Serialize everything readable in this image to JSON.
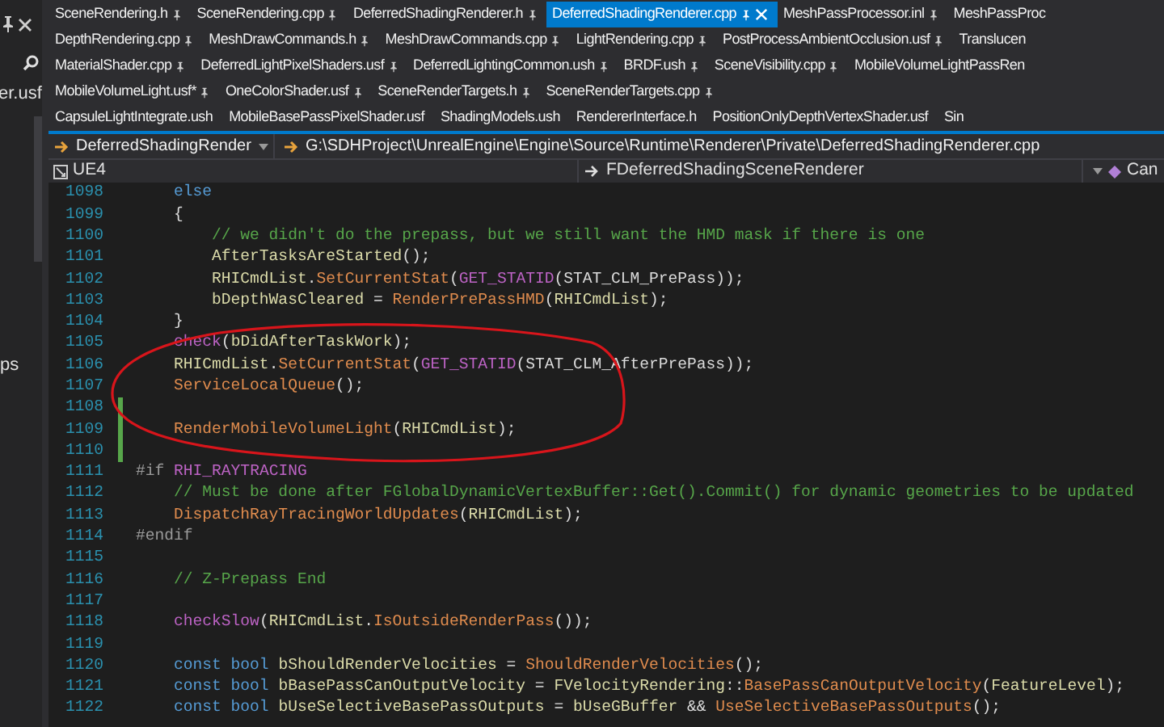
{
  "left_panel": {
    "items": [
      "er.usf",
      "ps"
    ]
  },
  "tab_rows": [
    [
      {
        "label": "SceneRendering.h",
        "selected": false,
        "pinned": true
      },
      {
        "label": "SceneRendering.cpp",
        "selected": false,
        "pinned": true
      },
      {
        "label": "DeferredShadingRenderer.h",
        "selected": false,
        "pinned": true
      },
      {
        "label": "DeferredShadingRenderer.cpp",
        "selected": true,
        "pinned": true
      },
      {
        "label": "MeshPassProcessor.inl",
        "selected": false,
        "pinned": true
      },
      {
        "label": "MeshPassProc",
        "selected": false,
        "pinned": false
      }
    ],
    [
      {
        "label": "DepthRendering.cpp",
        "selected": false,
        "pinned": true
      },
      {
        "label": "MeshDrawCommands.h",
        "selected": false,
        "pinned": true
      },
      {
        "label": "MeshDrawCommands.cpp",
        "selected": false,
        "pinned": true
      },
      {
        "label": "LightRendering.cpp",
        "selected": false,
        "pinned": true
      },
      {
        "label": "PostProcessAmbientOcclusion.usf",
        "selected": false,
        "pinned": true
      },
      {
        "label": "Translucen",
        "selected": false,
        "pinned": false
      }
    ],
    [
      {
        "label": "MaterialShader.cpp",
        "selected": false,
        "pinned": true
      },
      {
        "label": "DeferredLightPixelShaders.usf",
        "selected": false,
        "pinned": true
      },
      {
        "label": "DeferredLightingCommon.ush",
        "selected": false,
        "pinned": true
      },
      {
        "label": "BRDF.ush",
        "selected": false,
        "pinned": true
      },
      {
        "label": "SceneVisibility.cpp",
        "selected": false,
        "pinned": true
      },
      {
        "label": "MobileVolumeLightPassRen",
        "selected": false,
        "pinned": false
      }
    ],
    [
      {
        "label": "MobileVolumeLight.usf*",
        "selected": false,
        "pinned": true
      },
      {
        "label": "OneColorShader.usf",
        "selected": false,
        "pinned": true
      },
      {
        "label": "SceneRenderTargets.h",
        "selected": false,
        "pinned": true
      },
      {
        "label": "SceneRenderTargets.cpp",
        "selected": false,
        "pinned": true
      }
    ],
    [
      {
        "label": "CapsuleLightIntegrate.ush",
        "selected": false,
        "pinned": false
      },
      {
        "label": "MobileBasePassPixelShader.usf",
        "selected": false,
        "pinned": false
      },
      {
        "label": "ShadingModels.ush",
        "selected": false,
        "pinned": false
      },
      {
        "label": "RendererInterface.h",
        "selected": false,
        "pinned": false
      },
      {
        "label": "PositionOnlyDepthVertexShader.usf",
        "selected": false,
        "pinned": false
      },
      {
        "label": "Sin",
        "selected": false,
        "pinned": false
      }
    ]
  ],
  "navigation": {
    "project": "DeferredShadingRender",
    "path": "G:\\SDHProject\\UnrealEngine\\Engine\\Source\\Runtime\\Renderer\\Private\\DeferredShadingRenderer.cpp"
  },
  "breadcrumb": {
    "project": "UE4",
    "scope": "FDeferredShadingSceneRenderer",
    "member": "Can"
  },
  "editor": {
    "lines": [
      {
        "number": "1098",
        "modified": false,
        "tokens": [
          {
            "kind": "keyword",
            "text": "    else"
          }
        ]
      },
      {
        "number": "1099",
        "modified": false,
        "tokens": [
          {
            "kind": "plain",
            "text": "    {"
          }
        ]
      },
      {
        "number": "1100",
        "modified": false,
        "tokens": [
          {
            "kind": "comment",
            "text": "        // we didn't do the prepass, but we still want the HMD mask if there is one"
          }
        ]
      },
      {
        "number": "1101",
        "modified": false,
        "tokens": [
          {
            "kind": "variable",
            "text": "        AfterTasksAreStarted"
          },
          {
            "kind": "plain",
            "text": "();"
          }
        ]
      },
      {
        "number": "1102",
        "modified": false,
        "tokens": [
          {
            "kind": "variable",
            "text": "        RHICmdList"
          },
          {
            "kind": "plain",
            "text": "."
          },
          {
            "kind": "function",
            "text": "SetCurrentStat"
          },
          {
            "kind": "plain",
            "text": "("
          },
          {
            "kind": "macro",
            "text": "GET_STATID"
          },
          {
            "kind": "plain",
            "text": "(STAT_CLM_PrePass));"
          }
        ]
      },
      {
        "number": "1103",
        "modified": false,
        "tokens": [
          {
            "kind": "variable",
            "text": "        bDepthWasCleared"
          },
          {
            "kind": "plain",
            "text": " = "
          },
          {
            "kind": "function",
            "text": "RenderPrePassHMD"
          },
          {
            "kind": "plain",
            "text": "("
          },
          {
            "kind": "variable",
            "text": "RHICmdList"
          },
          {
            "kind": "plain",
            "text": ");"
          }
        ]
      },
      {
        "number": "1104",
        "modified": false,
        "tokens": [
          {
            "kind": "plain",
            "text": "    }"
          }
        ]
      },
      {
        "number": "1105",
        "modified": false,
        "tokens": [
          {
            "kind": "macro",
            "text": "    check"
          },
          {
            "kind": "plain",
            "text": "("
          },
          {
            "kind": "variable",
            "text": "bDidAfterTaskWork"
          },
          {
            "kind": "plain",
            "text": ");"
          }
        ]
      },
      {
        "number": "1106",
        "modified": false,
        "tokens": [
          {
            "kind": "variable",
            "text": "    RHICmdList"
          },
          {
            "kind": "plain",
            "text": "."
          },
          {
            "kind": "function",
            "text": "SetCurrentStat"
          },
          {
            "kind": "plain",
            "text": "("
          },
          {
            "kind": "macro",
            "text": "GET_STATID"
          },
          {
            "kind": "plain",
            "text": "(STAT_CLM_AfterPrePass));"
          }
        ]
      },
      {
        "number": "1107",
        "modified": false,
        "tokens": [
          {
            "kind": "function",
            "text": "    ServiceLocalQueue"
          },
          {
            "kind": "plain",
            "text": "();"
          }
        ]
      },
      {
        "number": "1108",
        "modified": true
      },
      {
        "number": "1109",
        "modified": true,
        "tokens": [
          {
            "kind": "function",
            "text": "    RenderMobileVolumeLight"
          },
          {
            "kind": "plain",
            "text": "("
          },
          {
            "kind": "variable",
            "text": "RHICmdList"
          },
          {
            "kind": "plain",
            "text": ");"
          }
        ]
      },
      {
        "number": "1110",
        "modified": true
      },
      {
        "number": "1111",
        "modified": false,
        "tokens": [
          {
            "kind": "preprocessor",
            "text": "#if "
          },
          {
            "kind": "macro",
            "text": "RHI_RAYTRACING"
          }
        ]
      },
      {
        "number": "1112",
        "modified": false,
        "tokens": [
          {
            "kind": "comment",
            "text": "    // Must be done after FGlobalDynamicVertexBuffer::Get().Commit() for dynamic geometries to be updated"
          }
        ]
      },
      {
        "number": "1113",
        "modified": false,
        "tokens": [
          {
            "kind": "function",
            "text": "    DispatchRayTracingWorldUpdates"
          },
          {
            "kind": "plain",
            "text": "("
          },
          {
            "kind": "variable",
            "text": "RHICmdList"
          },
          {
            "kind": "plain",
            "text": ");"
          }
        ]
      },
      {
        "number": "1114",
        "modified": false,
        "tokens": [
          {
            "kind": "preprocessor",
            "text": "#endif"
          }
        ]
      },
      {
        "number": "1115",
        "modified": false
      },
      {
        "number": "1116",
        "modified": false,
        "tokens": [
          {
            "kind": "comment",
            "text": "    // Z-Prepass End"
          }
        ]
      },
      {
        "number": "1117",
        "modified": false
      },
      {
        "number": "1118",
        "modified": false,
        "tokens": [
          {
            "kind": "macro",
            "text": "    checkSlow"
          },
          {
            "kind": "plain",
            "text": "("
          },
          {
            "kind": "variable",
            "text": "RHICmdList"
          },
          {
            "kind": "plain",
            "text": "."
          },
          {
            "kind": "function",
            "text": "IsOutsideRenderPass"
          },
          {
            "kind": "plain",
            "text": "());"
          }
        ]
      },
      {
        "number": "1119",
        "modified": false
      },
      {
        "number": "1120",
        "modified": false,
        "tokens": [
          {
            "kind": "keyword",
            "text": "    const bool "
          },
          {
            "kind": "variable",
            "text": "bShouldRenderVelocities"
          },
          {
            "kind": "plain",
            "text": " = "
          },
          {
            "kind": "function",
            "text": "ShouldRenderVelocities"
          },
          {
            "kind": "plain",
            "text": "();"
          }
        ]
      },
      {
        "number": "1121",
        "modified": false,
        "tokens": [
          {
            "kind": "keyword",
            "text": "    const bool "
          },
          {
            "kind": "variable",
            "text": "bBasePassCanOutputVelocity"
          },
          {
            "kind": "plain",
            "text": " = "
          },
          {
            "kind": "variable",
            "text": "FVelocityRendering"
          },
          {
            "kind": "plain",
            "text": "::"
          },
          {
            "kind": "function",
            "text": "BasePassCanOutputVelocity"
          },
          {
            "kind": "plain",
            "text": "("
          },
          {
            "kind": "variable",
            "text": "FeatureLevel"
          },
          {
            "kind": "plain",
            "text": ");"
          }
        ]
      },
      {
        "number": "1122",
        "modified": false,
        "tokens": [
          {
            "kind": "keyword",
            "text": "    const bool "
          },
          {
            "kind": "variable",
            "text": "bUseSelectiveBasePassOutputs"
          },
          {
            "kind": "plain",
            "text": " = "
          },
          {
            "kind": "variable",
            "text": "bUseGBuffer"
          },
          {
            "kind": "plain",
            "text": " && "
          },
          {
            "kind": "function",
            "text": "UseSelectiveBasePassOutputs"
          },
          {
            "kind": "plain",
            "text": "();"
          }
        ]
      }
    ]
  }
}
